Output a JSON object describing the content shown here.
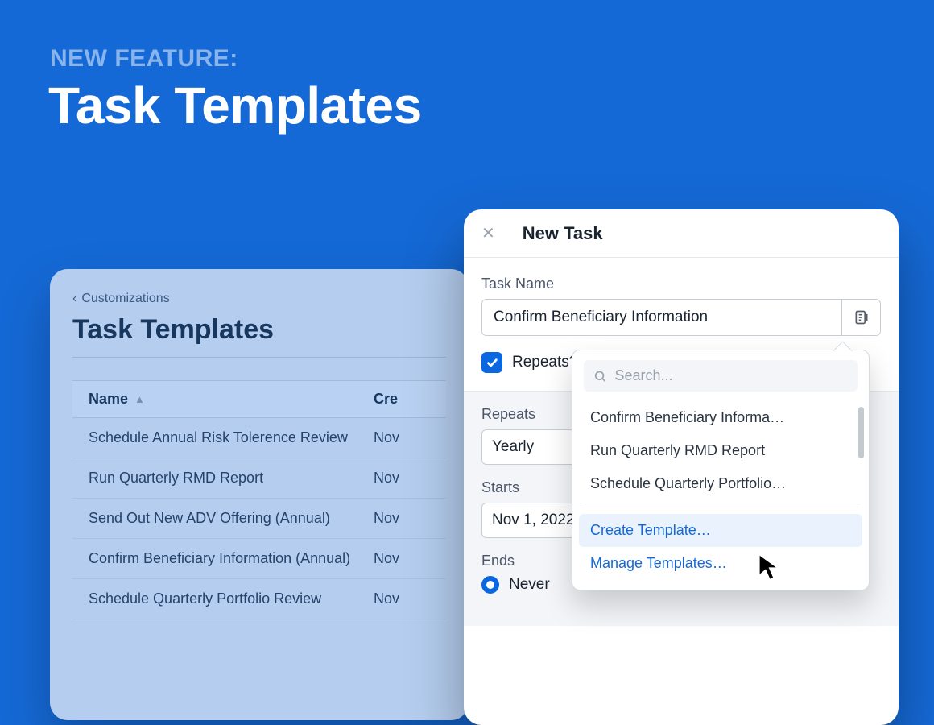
{
  "hero": {
    "kicker": "NEW FEATURE:",
    "title": "Task Templates"
  },
  "templates_panel": {
    "breadcrumb": "Customizations",
    "heading": "Task Templates",
    "columns": {
      "name": "Name",
      "created": "Cre"
    },
    "rows": [
      {
        "name": "Schedule Annual Risk Tolerence Review",
        "created": "Nov"
      },
      {
        "name": "Run Quarterly RMD Report",
        "created": "Nov"
      },
      {
        "name": "Send Out New ADV Offering (Annual)",
        "created": "Nov"
      },
      {
        "name": "Confirm Beneficiary Information (Annual)",
        "created": "Nov"
      },
      {
        "name": "Schedule Quarterly Portfolio Review",
        "created": "Nov"
      }
    ]
  },
  "new_task": {
    "title": "New Task",
    "task_name_label": "Task Name",
    "task_name_value": "Confirm Beneficiary Information",
    "repeats_checkbox_label": "Repeats?",
    "repeats_checked": true,
    "repeats_label": "Repeats",
    "repeats_value": "Yearly",
    "starts_label": "Starts",
    "starts_value": "Nov 1, 2022",
    "ends_label": "Ends",
    "ends_option": "Never"
  },
  "template_popover": {
    "search_placeholder": "Search...",
    "options": [
      "Confirm Beneficiary Informa…",
      "Run Quarterly RMD Report",
      "Schedule Quarterly Portfolio…"
    ],
    "actions": {
      "create": "Create Template…",
      "manage": "Manage Templates…"
    }
  }
}
